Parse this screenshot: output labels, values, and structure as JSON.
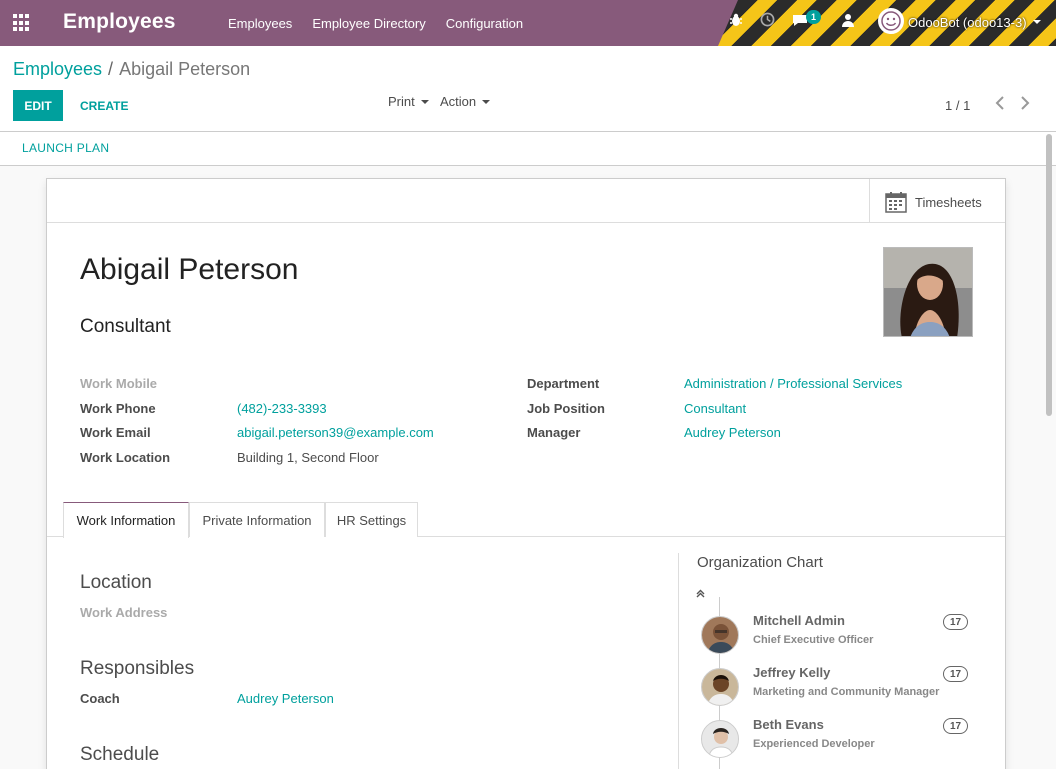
{
  "navbar": {
    "brand": "Employees",
    "menu": [
      "Employees",
      "Employee Directory",
      "Configuration"
    ],
    "chat_badge": "1",
    "user": "OdooBot (odoo13-3)",
    "colors": {
      "navbar": "#875a7b",
      "accent": "#00a09d",
      "stripe_yellow": "#f5c518"
    },
    "icons": [
      "apps-grid-icon",
      "bug-icon",
      "clock-icon",
      "chat-icon",
      "activity-icon",
      "user-avatar-icon"
    ]
  },
  "breadcrumb": {
    "parent": "Employees",
    "separator": "/",
    "current": "Abigail Peterson"
  },
  "toolbar": {
    "edit": "EDIT",
    "create": "CREATE",
    "print": "Print",
    "action": "Action"
  },
  "pager": {
    "value": "1 / 1",
    "prev": "‹",
    "next": "›"
  },
  "statusbar": {
    "launch_plan": "LAUNCH PLAN"
  },
  "button_box": {
    "timesheets": "Timesheets"
  },
  "employee": {
    "name": "Abigail Peterson",
    "job_title": "Consultant",
    "left_fields": [
      {
        "label": "Work Mobile",
        "value": ""
      },
      {
        "label": "Work Phone",
        "value": "(482)-233-3393"
      },
      {
        "label": "Work Email",
        "value": "abigail.peterson39@example.com"
      },
      {
        "label": "Work Location",
        "value": "Building 1, Second Floor"
      }
    ],
    "right_fields": [
      {
        "label": "Department",
        "value": "Administration / Professional Services"
      },
      {
        "label": "Job Position",
        "value": "Consultant"
      },
      {
        "label": "Manager",
        "value": "Audrey Peterson"
      }
    ]
  },
  "tabs": [
    "Work Information",
    "Private Information",
    "HR Settings"
  ],
  "work_info": {
    "location_title": "Location",
    "work_address_label": "Work Address",
    "responsibles_title": "Responsibles",
    "coach_label": "Coach",
    "coach_value": "Audrey Peterson",
    "schedule_title": "Schedule"
  },
  "org_chart": {
    "title": "Organization Chart",
    "people": [
      {
        "name": "Mitchell Admin",
        "job": "Chief Executive Officer",
        "count": "17"
      },
      {
        "name": "Jeffrey Kelly",
        "job": "Marketing and Community Manager",
        "count": "17"
      },
      {
        "name": "Beth Evans",
        "job": "Experienced Developer",
        "count": "17"
      }
    ]
  }
}
